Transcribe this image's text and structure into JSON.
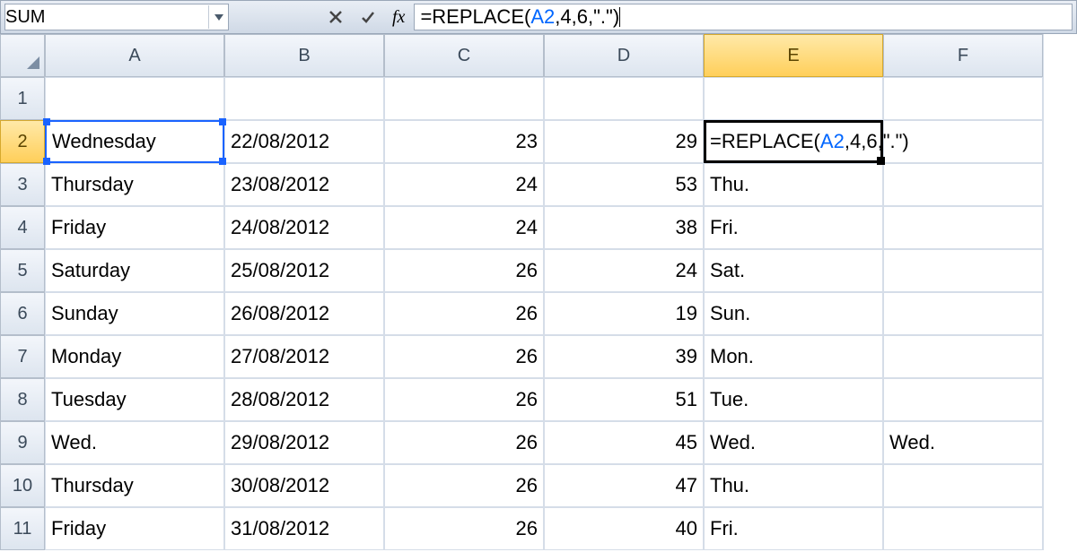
{
  "formula_bar": {
    "name_box": "SUM",
    "cancel_title": "Cancel",
    "enter_title": "Enter",
    "fx_label": "fx",
    "formula_plain": "=REPLACE(A2,4,6,\".\")",
    "formula_tokens": [
      {
        "cls": "tok-fn",
        "t": "=REPLACE("
      },
      {
        "cls": "tok-ref",
        "t": "A2"
      },
      {
        "cls": "tok-fn",
        "t": ","
      },
      {
        "cls": "tok-num",
        "t": "4"
      },
      {
        "cls": "tok-fn",
        "t": ","
      },
      {
        "cls": "tok-num",
        "t": "6"
      },
      {
        "cls": "tok-fn",
        "t": ","
      },
      {
        "cls": "tok-str",
        "t": "\".\""
      },
      {
        "cls": "tok-fn",
        "t": ")"
      }
    ]
  },
  "columns": [
    "A",
    "B",
    "C",
    "D",
    "E",
    "F"
  ],
  "active_column_index": 4,
  "row_headers": [
    "1",
    "2",
    "3",
    "4",
    "5",
    "6",
    "7",
    "8",
    "9",
    "10",
    "11"
  ],
  "active_row_index": 1,
  "active_cell": "E2",
  "referenced_cell": "A2",
  "rows": [
    {
      "A": "",
      "B": "",
      "C": "",
      "D": "",
      "E": "",
      "F": ""
    },
    {
      "A": "Wednesday",
      "B": "22/08/2012",
      "C": "23",
      "D": "29",
      "E": "=REPLACE(A2,4,6,\".\")",
      "F": ""
    },
    {
      "A": "Thursday",
      "B": "23/08/2012",
      "C": "24",
      "D": "53",
      "E": "Thu.",
      "F": ""
    },
    {
      "A": "Friday",
      "B": "24/08/2012",
      "C": "24",
      "D": "38",
      "E": "Fri.",
      "F": ""
    },
    {
      "A": "Saturday",
      "B": "25/08/2012",
      "C": "26",
      "D": "24",
      "E": "Sat.",
      "F": ""
    },
    {
      "A": "Sunday",
      "B": "26/08/2012",
      "C": "26",
      "D": "19",
      "E": "Sun.",
      "F": ""
    },
    {
      "A": "Monday",
      "B": "27/08/2012",
      "C": "26",
      "D": "39",
      "E": "Mon.",
      "F": ""
    },
    {
      "A": "Tuesday",
      "B": "28/08/2012",
      "C": "26",
      "D": "51",
      "E": "Tue.",
      "F": ""
    },
    {
      "A": "Wed.",
      "B": "29/08/2012",
      "C": "26",
      "D": "45",
      "E": "Wed.",
      "F": "Wed."
    },
    {
      "A": "Thursday",
      "B": "30/08/2012",
      "C": "26",
      "D": "47",
      "E": "Thu.",
      "F": ""
    },
    {
      "A": "Friday",
      "B": "31/08/2012",
      "C": "26",
      "D": "40",
      "E": "Fri.",
      "F": ""
    }
  ],
  "cell_alignment": {
    "A": "txt",
    "B": "txt",
    "C": "num",
    "D": "num",
    "E": "txt",
    "F": "txt"
  },
  "edit_cell_tokens": [
    {
      "cls": "tok-fn",
      "t": "=REPLACE("
    },
    {
      "cls": "tok-ref",
      "t": "A2"
    },
    {
      "cls": "tok-fn",
      "t": ","
    },
    {
      "cls": "tok-num",
      "t": "4"
    },
    {
      "cls": "tok-fn",
      "t": ","
    },
    {
      "cls": "tok-num",
      "t": "6"
    },
    {
      "cls": "tok-fn",
      "t": ","
    },
    {
      "cls": "tok-str",
      "t": "\".\""
    },
    {
      "cls": "tok-fn",
      "t": ")"
    }
  ]
}
